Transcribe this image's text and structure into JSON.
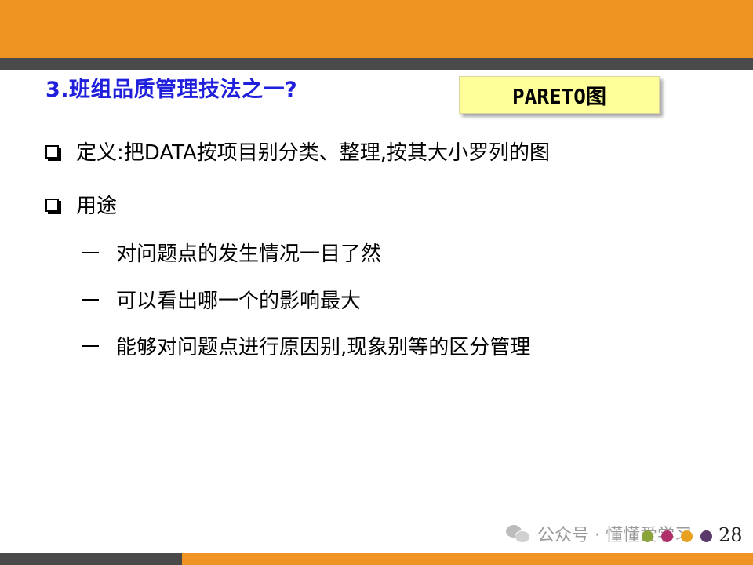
{
  "slide": {
    "title": "3.班组品质管理技法之一?",
    "badge": "PARETO图",
    "bullets": [
      {
        "text": "定义:把DATA按项目别分类、整理,按其大小罗列的图"
      },
      {
        "text": "用途"
      }
    ],
    "sub_items": [
      {
        "text": "对问题点的发生情况一目了然"
      },
      {
        "text": "可以看出哪一个的影响最大"
      },
      {
        "text": "能够对问题点进行原因别,现象别等的区分管理"
      }
    ],
    "page_number": "28"
  },
  "watermark": {
    "text": "公众号 · 懂懂爱学习",
    "icon": "wechat-icon"
  },
  "colors": {
    "header_orange": "#ef9322",
    "stripe_gray": "#4a4a4a",
    "title_blue": "#1f1fdc",
    "badge_yellow": "#ffff99",
    "dot_colors": [
      "#8aa33a",
      "#b0306a",
      "#e8a020",
      "#5a3a6a"
    ]
  }
}
